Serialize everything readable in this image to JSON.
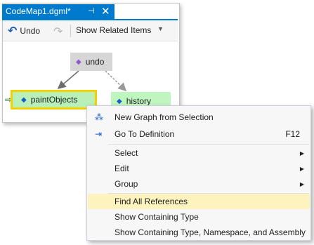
{
  "window": {
    "tab_title": "CodeMap1.dgml*",
    "pin_glyph": "⊣",
    "close_glyph": "✕"
  },
  "toolbar": {
    "undo_label": "Undo",
    "show_related_label": "Show Related Items"
  },
  "graph": {
    "nodes": [
      {
        "label": "undo",
        "fill": "#d6d6d6"
      },
      {
        "label": "paintObjects",
        "fill": "#b8f0b8",
        "border": "#f5d000"
      },
      {
        "label": "history",
        "fill": "#bff5bf"
      }
    ]
  },
  "context_menu": {
    "items": [
      {
        "label": "New Graph from Selection",
        "icon": "new-graph-icon"
      },
      {
        "label": "Go To Definition",
        "shortcut": "F12",
        "icon": "go-to-definition-icon"
      },
      {
        "label": "Select",
        "submenu": true
      },
      {
        "label": "Edit",
        "submenu": true
      },
      {
        "label": "Group",
        "submenu": true
      },
      {
        "label": "Find All References",
        "highlighted": true
      },
      {
        "label": "Show Containing Type"
      },
      {
        "label": "Show Containing Type, Namespace, and Assembly"
      }
    ]
  },
  "colors": {
    "accent": "#007acc",
    "highlight": "#fcf3bf",
    "selection_border": "#f5d000"
  }
}
